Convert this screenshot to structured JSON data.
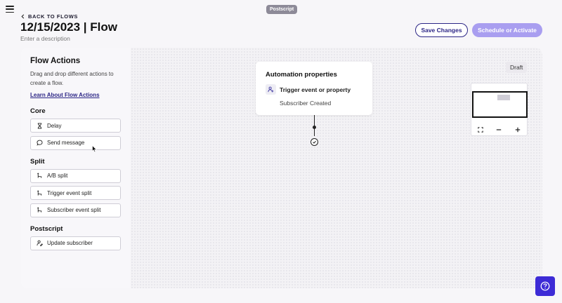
{
  "header": {
    "back_label": "BACK TO FLOWS",
    "brand_badge": "Postscript",
    "title": "12/15/2023 | Flow",
    "description_placeholder": "Enter a description",
    "save_label": "Save Changes",
    "schedule_label": "Schedule or Activate"
  },
  "sidebar": {
    "title": "Flow Actions",
    "help_text": "Drag and drop different actions to create a flow.",
    "learn_link": "Learn About Flow Actions",
    "sections": [
      {
        "title": "Core",
        "items": [
          {
            "label": "Delay",
            "icon": "hourglass-icon"
          },
          {
            "label": "Send message",
            "icon": "message-icon"
          }
        ]
      },
      {
        "title": "Split",
        "items": [
          {
            "label": "A/B split",
            "icon": "split-icon"
          },
          {
            "label": "Trigger event split",
            "icon": "split-icon"
          },
          {
            "label": "Subscriber event split",
            "icon": "split-icon"
          }
        ]
      },
      {
        "title": "Postscript",
        "items": [
          {
            "label": "Update subscriber",
            "icon": "user-edit-icon"
          }
        ]
      }
    ]
  },
  "canvas": {
    "status": "Draft",
    "node": {
      "title": "Automation properties",
      "trigger_label": "Trigger event or property",
      "trigger_value": "Subscriber Created"
    }
  },
  "colors": {
    "accent": "#2c2686",
    "accent_light": "#a99ef0",
    "fab": "#3d2bd6"
  }
}
